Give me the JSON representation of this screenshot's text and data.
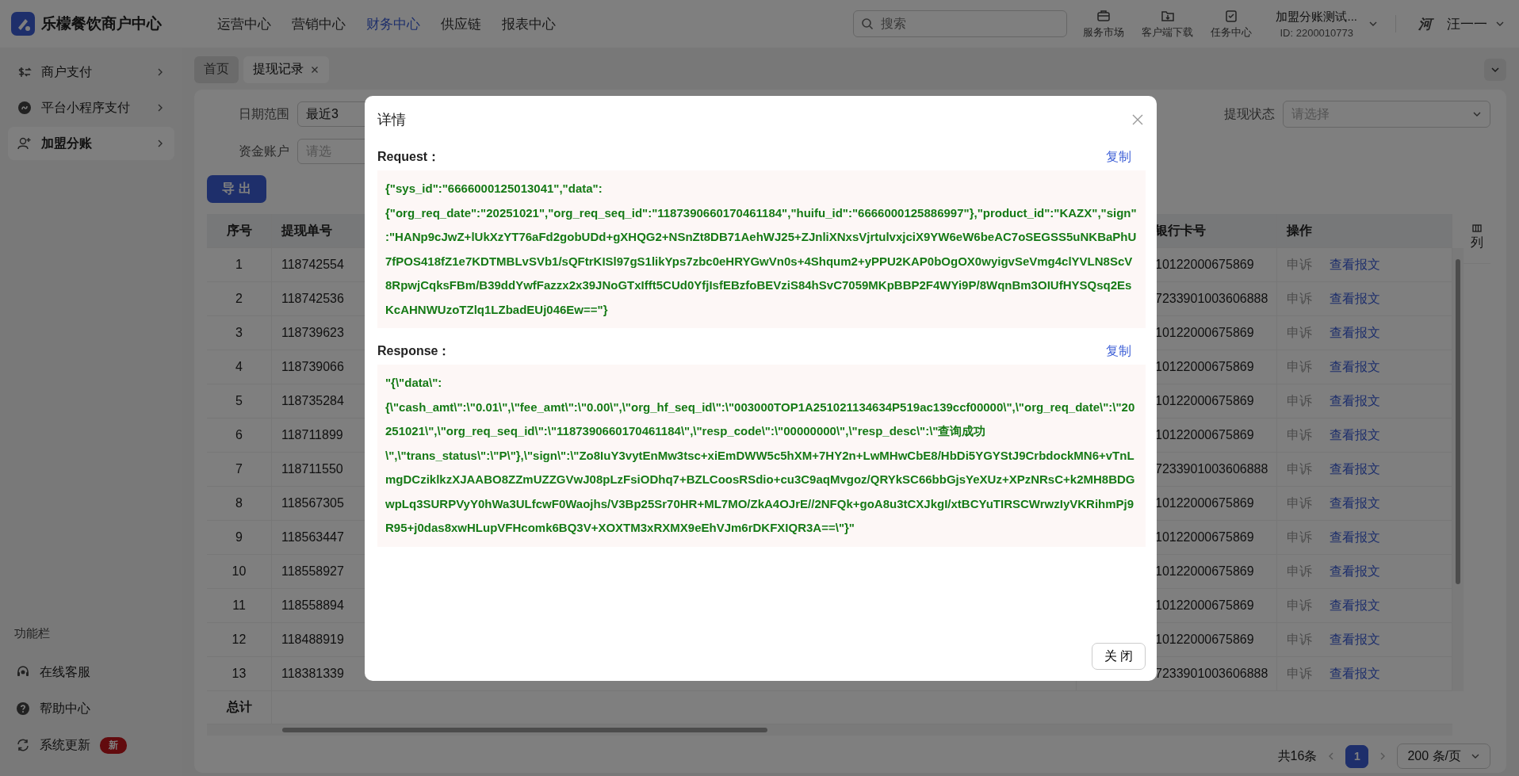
{
  "header": {
    "logo_text": "乐檬餐饮商户中心",
    "nav": [
      {
        "label": "运营中心",
        "selected": false
      },
      {
        "label": "营销中心",
        "selected": false
      },
      {
        "label": "财务中心",
        "selected": true
      },
      {
        "label": "供应链",
        "selected": false
      },
      {
        "label": "报表中心",
        "selected": false
      }
    ],
    "search": {
      "placeholder": "搜索"
    },
    "tools": [
      {
        "label": "服务市场"
      },
      {
        "label": "客户端下载"
      },
      {
        "label": "任务中心"
      }
    ],
    "account": {
      "name": "加盟分账测试...",
      "id": "ID: 2200010773"
    },
    "avatar": "河",
    "user": "汪一一"
  },
  "sidebar": {
    "items": [
      {
        "label": "商户支付",
        "selected": false
      },
      {
        "label": "平台小程序支付",
        "selected": false
      },
      {
        "label": "加盟分账",
        "selected": true
      }
    ],
    "section_title": "功能栏",
    "tools": [
      {
        "label": "在线客服"
      },
      {
        "label": "帮助中心"
      },
      {
        "label": "系统更新",
        "badge": "新"
      }
    ]
  },
  "tabs": [
    {
      "label": "首页",
      "selected": false,
      "closable": false
    },
    {
      "label": "提现记录",
      "selected": true,
      "closable": true
    }
  ],
  "filters": [
    {
      "label": "日期范围",
      "value": "最近3"
    },
    {
      "label": "资金账户",
      "placeholder": "请选"
    },
    {
      "label": "提现状态",
      "placeholder": "请选择"
    }
  ],
  "export_button": "导 出",
  "table": {
    "columns": [
      "序号",
      "提现单号",
      "银行卡号",
      "操作"
    ],
    "column_settings": "列",
    "rows": [
      {
        "index": "1",
        "number": "118742554",
        "card": "10122000675869",
        "actions": [
          {
            "label": "申诉",
            "kind": "muted"
          },
          {
            "label": "查看报文",
            "kind": "link"
          }
        ]
      },
      {
        "index": "2",
        "number": "118742536",
        "card": "7233901003606888",
        "actions": [
          {
            "label": "申诉",
            "kind": "muted"
          },
          {
            "label": "查看报文",
            "kind": "link"
          }
        ]
      },
      {
        "index": "3",
        "number": "118739623",
        "card": "10122000675869",
        "actions": [
          {
            "label": "申诉",
            "kind": "muted"
          },
          {
            "label": "查看报文",
            "kind": "link"
          }
        ]
      },
      {
        "index": "4",
        "number": "118739066",
        "card": "10122000675869",
        "actions": [
          {
            "label": "申诉",
            "kind": "muted"
          },
          {
            "label": "查看报文",
            "kind": "link"
          }
        ]
      },
      {
        "index": "5",
        "number": "118735284",
        "card": "10122000675869",
        "actions": [
          {
            "label": "申诉",
            "kind": "muted"
          },
          {
            "label": "查看报文",
            "kind": "link"
          }
        ]
      },
      {
        "index": "6",
        "number": "118711899",
        "card": "10122000675869",
        "actions": [
          {
            "label": "申诉",
            "kind": "muted"
          },
          {
            "label": "查看报文",
            "kind": "link"
          }
        ]
      },
      {
        "index": "7",
        "number": "118711550",
        "card": "7233901003606888",
        "actions": [
          {
            "label": "申诉",
            "kind": "muted"
          },
          {
            "label": "查看报文",
            "kind": "link"
          }
        ]
      },
      {
        "index": "8",
        "number": "118567305",
        "card": "10122000675869",
        "actions": [
          {
            "label": "申诉",
            "kind": "muted"
          },
          {
            "label": "查看报文",
            "kind": "link"
          }
        ]
      },
      {
        "index": "9",
        "number": "118563447",
        "card": "10122000675869",
        "actions": [
          {
            "label": "申诉",
            "kind": "muted"
          },
          {
            "label": "查看报文",
            "kind": "link"
          }
        ]
      },
      {
        "index": "10",
        "number": "118558927",
        "card": "10122000675869",
        "actions": [
          {
            "label": "申诉",
            "kind": "muted"
          },
          {
            "label": "查看报文",
            "kind": "link"
          }
        ]
      },
      {
        "index": "11",
        "number": "118558894",
        "card": "10122000675869",
        "actions": [
          {
            "label": "申诉",
            "kind": "muted"
          },
          {
            "label": "查看报文",
            "kind": "link"
          }
        ]
      },
      {
        "index": "12",
        "number": "118488919",
        "card": "10122000675869",
        "actions": [
          {
            "label": "申诉",
            "kind": "muted"
          },
          {
            "label": "查看报文",
            "kind": "link"
          }
        ]
      },
      {
        "index": "13",
        "number": "118381339",
        "card": "7233901003606888",
        "actions": [
          {
            "label": "申诉",
            "kind": "muted"
          },
          {
            "label": "查看报文",
            "kind": "link"
          }
        ]
      }
    ],
    "total_label": "总计"
  },
  "pagination": {
    "total": "共16条",
    "pages": [
      {
        "label": "1",
        "selected": true
      }
    ],
    "page_size": "200 条/页"
  },
  "dialog": {
    "title": "详情",
    "close_button": "关 闭",
    "sections": [
      {
        "label": "Request：",
        "copy": "复制",
        "body": "{\"sys_id\":\"6666000125013041\",\"data\":{\"org_req_date\":\"20251021\",\"org_req_seq_id\":\"1187390660170461184\",\"huifu_id\":\"6666000125886997\"},\"product_id\":\"KAZX\",\"sign\":\"HANp9cJwZ+lUkXzYT76aFd2gobUDd+gXHQG2+NSnZt8DB71AehWJ25+ZJnliXNxsVjrtulvxjciX9YW6eW6beAC7oSEGSS5uNKBaPhU7fPOS418fZ1e7KDTMBLvSVb1/sQFtrKISl97gS1likYps7zbc0eHRYGwVn0s+4Shqum2+yPPU2KAP0bOgOX0wyigvSeVmg4clYVLN8ScV8RpwjCqksFBm/B39ddYwfFazzx2x39JNoGTxIfft5CUd0YfjIsfEBzfoBEVziS84hSvC7059MKpBBP2F4WYi9P/8WqnBm3OIUfHYSQsq2EsKcAHNWUzoTZlq1LZbadEUj046Ew==\"}"
      },
      {
        "label": "Response：",
        "copy": "复制",
        "body": "\"{\\\"data\\\":{\\\"cash_amt\\\":\\\"0.01\\\",\\\"fee_amt\\\":\\\"0.00\\\",\\\"org_hf_seq_id\\\":\\\"003000TOP1A251021134634P519ac139ccf00000\\\",\\\"org_req_date\\\":\\\"20251021\\\",\\\"org_req_seq_id\\\":\\\"1187390660170461184\\\",\\\"resp_code\\\":\\\"00000000\\\",\\\"resp_desc\\\":\\\"查询成功\\\",\\\"trans_status\\\":\\\"P\\\"},\\\"sign\\\":\\\"Zo8IuY3vytEnMw3tsc+xiEmDWW5c5hXM+7HY2n+LwMHwCbE8/HbDi5YGYStJ9CrbdockMN6+vTnLmgDCziklkzXJAABO8ZZmUZZGVwJ08pLzFsiODhq7+BZLCoosRSdio+cu3C9aqMvgoz/QRYkSC66bbGjsYeXUz+XPzNRsC+k2MH8BDGwpLq3SURPVyY0hWa3ULfcwF0Waojhs/V3Bp25Sr70HR+ML7MO/ZkA4OJrE//2NFQk+goA8u3tCXJkgI/xtBCYuTIRSCWrwzIyVKRihmPj9R95+j0das8xwHLupVFHcomk6BQ3V+XOXTM3xRXMX9eEhVJm6rDKFXIQR3A==\\\"}\""
      }
    ]
  }
}
